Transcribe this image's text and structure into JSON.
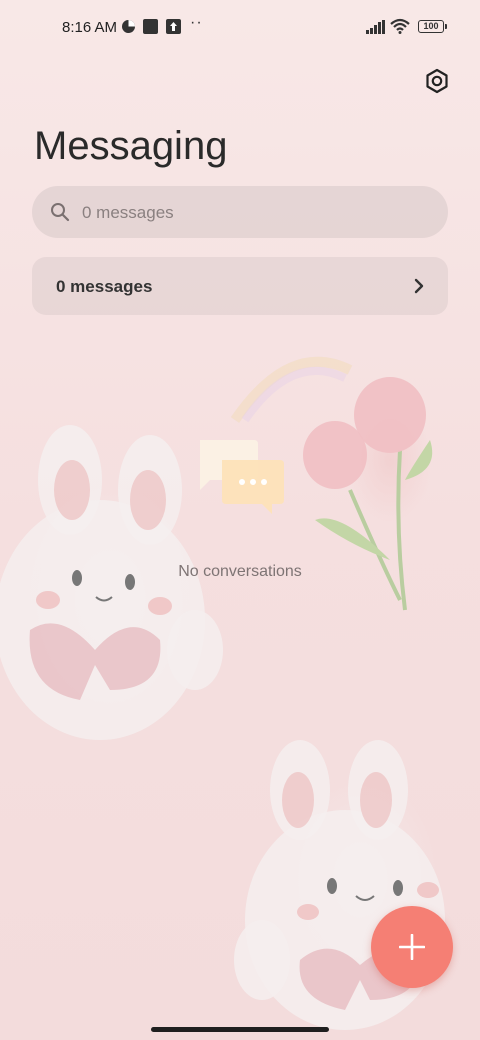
{
  "status_bar": {
    "time": "8:16 AM",
    "battery": "100",
    "more_dots": "··"
  },
  "header": {
    "title": "Messaging",
    "settings_icon": "gear-icon"
  },
  "search": {
    "placeholder": "0 messages",
    "icon": "search-icon"
  },
  "summary": {
    "label": "0 messages",
    "icon": "chevron-right-icon"
  },
  "empty_state": {
    "text": "No conversations",
    "icon": "chat-bubbles-icon"
  },
  "fab": {
    "icon": "plus-icon",
    "color": "#f57f74"
  }
}
